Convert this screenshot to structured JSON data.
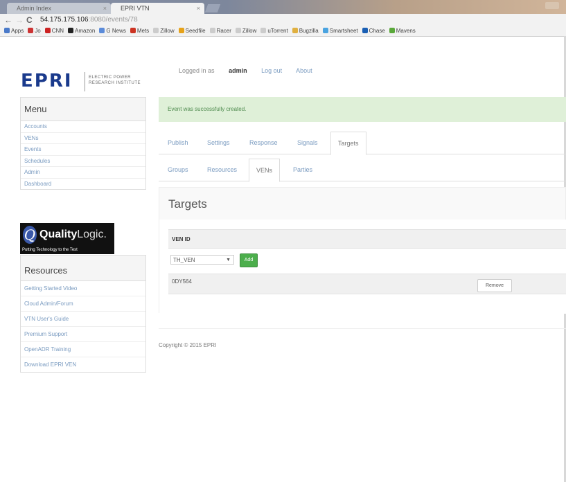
{
  "browser": {
    "tabs": [
      {
        "label": "Admin Index",
        "close": "×"
      },
      {
        "label": "EPRI VTN",
        "close": "×"
      }
    ],
    "nav": {
      "back": "←",
      "forward": "→",
      "reload": "C"
    },
    "url": {
      "host": "54.175.175.106",
      "path": ":8080/events/78"
    },
    "bookmarks": [
      {
        "label": "Apps",
        "color": "#4a7ac9"
      },
      {
        "label": "Jo",
        "color": "#cc3333"
      },
      {
        "label": "CNN",
        "color": "#cc2222"
      },
      {
        "label": "Amazon",
        "color": "#222222"
      },
      {
        "label": "G News",
        "color": "#5b8bd9"
      },
      {
        "label": "Mets",
        "color": "#cc3322"
      },
      {
        "label": "Zillow",
        "color": "#cccccc"
      },
      {
        "label": "Seedfile",
        "color": "#e6a21a"
      },
      {
        "label": "Racer",
        "color": "#cccccc"
      },
      {
        "label": "Zillow",
        "color": "#cccccc"
      },
      {
        "label": "uTorrent",
        "color": "#cccccc"
      },
      {
        "label": "Bugzilla",
        "color": "#e0b040"
      },
      {
        "label": "Smartsheet",
        "color": "#4aa3e0"
      },
      {
        "label": "Chase",
        "color": "#1a5fb4"
      },
      {
        "label": "Mavens",
        "color": "#5aa83a"
      }
    ]
  },
  "header": {
    "logo_text": "EPRI",
    "logo_sub": "ELECTRIC POWER RESEARCH INSTITUTE",
    "logged_in_prefix": "Logged in as",
    "username": "admin",
    "logout": "Log out",
    "about": "About"
  },
  "menu": {
    "title": "Menu",
    "items": [
      "Accounts",
      "VENs",
      "Events",
      "Schedules",
      "Admin",
      "Dashboard"
    ]
  },
  "quality_logic": {
    "name_bold": "Quality",
    "name_light": "Logic.",
    "tagline": "Putting Technology to the Test"
  },
  "resources": {
    "title": "Resources",
    "items": [
      "Getting Started Video",
      "Cloud Admin/Forum",
      "VTN User's Guide",
      "Premium Support",
      "OpenADR Training",
      "Download EPRI VEN"
    ]
  },
  "alert": "Event was successfully created.",
  "tabs_primary": [
    "Publish",
    "Settings",
    "Response",
    "Signals",
    "Targets"
  ],
  "tabs_primary_active": "Targets",
  "tabs_secondary": [
    "Groups",
    "Resources",
    "VENs",
    "Parties"
  ],
  "tabs_secondary_active": "VENs",
  "targets": {
    "title": "Targets",
    "column_header": "VEN ID",
    "select_value": "TH_VEN",
    "add_label": "Add",
    "rows": [
      {
        "ven_id": "0DY564",
        "action": "Remove"
      }
    ]
  },
  "footer": "Copyright © 2015 EPRI"
}
